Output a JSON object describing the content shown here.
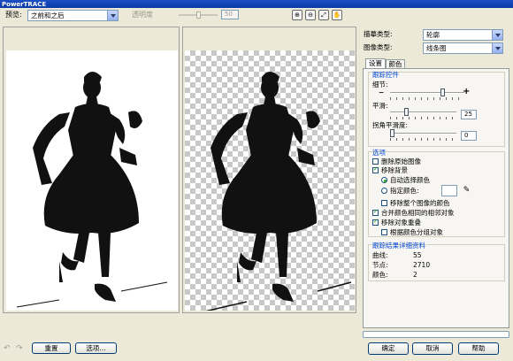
{
  "window": {
    "title": "PowerTRACE"
  },
  "toolbar": {
    "preview_label": "预览:",
    "preview_value": "之前和之后",
    "transparency_label": "透明度",
    "transparency_value": "50"
  },
  "tracing": {
    "trace_type_label": "描摹类型:",
    "trace_type_value": "轮廓",
    "image_type_label": "图像类型:",
    "image_type_value": "线条图"
  },
  "tabs": [
    {
      "label": "设置"
    },
    {
      "label": "颜色"
    }
  ],
  "trace_controls": {
    "title": "跟踪控件",
    "detail_label": "细节:",
    "detail_minus": "−",
    "detail_plus": "+",
    "detail_level": 0.7,
    "smoothing_label": "平滑:",
    "smoothing_value": "25",
    "corner_label": "拐角平滑度:",
    "corner_value": "0"
  },
  "options": {
    "title": "选项",
    "delete_original": {
      "label": "删除原始图像",
      "checked": false
    },
    "remove_background": {
      "label": "移除背景",
      "checked": true
    },
    "auto_color": {
      "label": "自动选择颜色",
      "selected": true
    },
    "specify_color": {
      "label": "指定颜色:",
      "selected": false
    },
    "remove_whole": {
      "label": "移除整个图像的颜色",
      "checked": false
    },
    "merge_adjacent": {
      "label": "合并颜色相同的相邻对象",
      "checked": true
    },
    "remove_overlap": {
      "label": "移除对象重叠",
      "checked": true
    },
    "group_by_color": {
      "label": "根据颜色分组对象",
      "checked": false
    }
  },
  "results": {
    "title": "跟踪结果详细资料",
    "curves_label": "曲线:",
    "curves_value": "55",
    "nodes_label": "节点:",
    "nodes_value": "2710",
    "colors_label": "颜色:",
    "colors_value": "2"
  },
  "bottom": {
    "reset_label": "重置",
    "options_label": "选项...",
    "ok_label": "确定",
    "cancel_label": "取消",
    "help_label": "帮助"
  },
  "colors": {
    "title_bar": "#0a3aa8",
    "group_title": "#0046d5",
    "check_green": "#21a121"
  }
}
